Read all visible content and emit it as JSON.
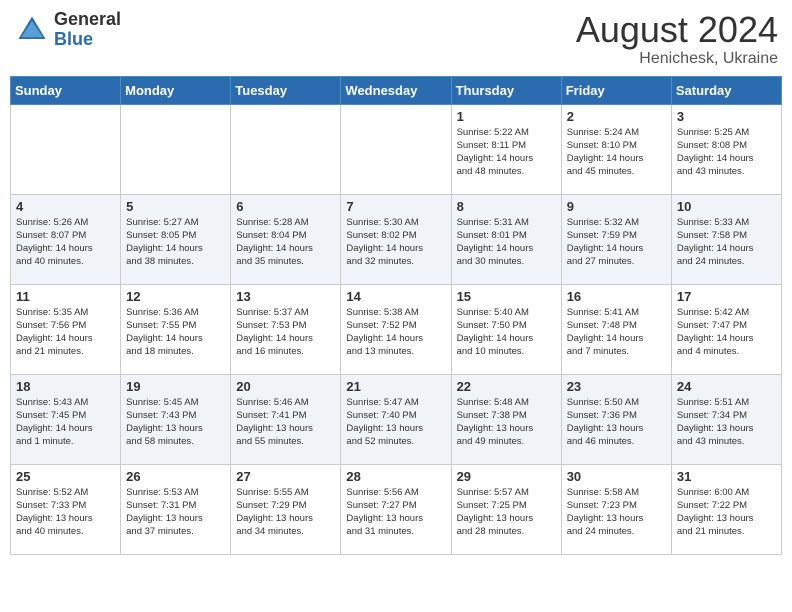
{
  "header": {
    "logo_general": "General",
    "logo_blue": "Blue",
    "month_year": "August 2024",
    "location": "Henichesk, Ukraine"
  },
  "days_of_week": [
    "Sunday",
    "Monday",
    "Tuesday",
    "Wednesday",
    "Thursday",
    "Friday",
    "Saturday"
  ],
  "weeks": [
    [
      {
        "day": "",
        "info": ""
      },
      {
        "day": "",
        "info": ""
      },
      {
        "day": "",
        "info": ""
      },
      {
        "day": "",
        "info": ""
      },
      {
        "day": "1",
        "info": "Sunrise: 5:22 AM\nSunset: 8:11 PM\nDaylight: 14 hours\nand 48 minutes."
      },
      {
        "day": "2",
        "info": "Sunrise: 5:24 AM\nSunset: 8:10 PM\nDaylight: 14 hours\nand 45 minutes."
      },
      {
        "day": "3",
        "info": "Sunrise: 5:25 AM\nSunset: 8:08 PM\nDaylight: 14 hours\nand 43 minutes."
      }
    ],
    [
      {
        "day": "4",
        "info": "Sunrise: 5:26 AM\nSunset: 8:07 PM\nDaylight: 14 hours\nand 40 minutes."
      },
      {
        "day": "5",
        "info": "Sunrise: 5:27 AM\nSunset: 8:05 PM\nDaylight: 14 hours\nand 38 minutes."
      },
      {
        "day": "6",
        "info": "Sunrise: 5:28 AM\nSunset: 8:04 PM\nDaylight: 14 hours\nand 35 minutes."
      },
      {
        "day": "7",
        "info": "Sunrise: 5:30 AM\nSunset: 8:02 PM\nDaylight: 14 hours\nand 32 minutes."
      },
      {
        "day": "8",
        "info": "Sunrise: 5:31 AM\nSunset: 8:01 PM\nDaylight: 14 hours\nand 30 minutes."
      },
      {
        "day": "9",
        "info": "Sunrise: 5:32 AM\nSunset: 7:59 PM\nDaylight: 14 hours\nand 27 minutes."
      },
      {
        "day": "10",
        "info": "Sunrise: 5:33 AM\nSunset: 7:58 PM\nDaylight: 14 hours\nand 24 minutes."
      }
    ],
    [
      {
        "day": "11",
        "info": "Sunrise: 5:35 AM\nSunset: 7:56 PM\nDaylight: 14 hours\nand 21 minutes."
      },
      {
        "day": "12",
        "info": "Sunrise: 5:36 AM\nSunset: 7:55 PM\nDaylight: 14 hours\nand 18 minutes."
      },
      {
        "day": "13",
        "info": "Sunrise: 5:37 AM\nSunset: 7:53 PM\nDaylight: 14 hours\nand 16 minutes."
      },
      {
        "day": "14",
        "info": "Sunrise: 5:38 AM\nSunset: 7:52 PM\nDaylight: 14 hours\nand 13 minutes."
      },
      {
        "day": "15",
        "info": "Sunrise: 5:40 AM\nSunset: 7:50 PM\nDaylight: 14 hours\nand 10 minutes."
      },
      {
        "day": "16",
        "info": "Sunrise: 5:41 AM\nSunset: 7:48 PM\nDaylight: 14 hours\nand 7 minutes."
      },
      {
        "day": "17",
        "info": "Sunrise: 5:42 AM\nSunset: 7:47 PM\nDaylight: 14 hours\nand 4 minutes."
      }
    ],
    [
      {
        "day": "18",
        "info": "Sunrise: 5:43 AM\nSunset: 7:45 PM\nDaylight: 14 hours\nand 1 minute."
      },
      {
        "day": "19",
        "info": "Sunrise: 5:45 AM\nSunset: 7:43 PM\nDaylight: 13 hours\nand 58 minutes."
      },
      {
        "day": "20",
        "info": "Sunrise: 5:46 AM\nSunset: 7:41 PM\nDaylight: 13 hours\nand 55 minutes."
      },
      {
        "day": "21",
        "info": "Sunrise: 5:47 AM\nSunset: 7:40 PM\nDaylight: 13 hours\nand 52 minutes."
      },
      {
        "day": "22",
        "info": "Sunrise: 5:48 AM\nSunset: 7:38 PM\nDaylight: 13 hours\nand 49 minutes."
      },
      {
        "day": "23",
        "info": "Sunrise: 5:50 AM\nSunset: 7:36 PM\nDaylight: 13 hours\nand 46 minutes."
      },
      {
        "day": "24",
        "info": "Sunrise: 5:51 AM\nSunset: 7:34 PM\nDaylight: 13 hours\nand 43 minutes."
      }
    ],
    [
      {
        "day": "25",
        "info": "Sunrise: 5:52 AM\nSunset: 7:33 PM\nDaylight: 13 hours\nand 40 minutes."
      },
      {
        "day": "26",
        "info": "Sunrise: 5:53 AM\nSunset: 7:31 PM\nDaylight: 13 hours\nand 37 minutes."
      },
      {
        "day": "27",
        "info": "Sunrise: 5:55 AM\nSunset: 7:29 PM\nDaylight: 13 hours\nand 34 minutes."
      },
      {
        "day": "28",
        "info": "Sunrise: 5:56 AM\nSunset: 7:27 PM\nDaylight: 13 hours\nand 31 minutes."
      },
      {
        "day": "29",
        "info": "Sunrise: 5:57 AM\nSunset: 7:25 PM\nDaylight: 13 hours\nand 28 minutes."
      },
      {
        "day": "30",
        "info": "Sunrise: 5:58 AM\nSunset: 7:23 PM\nDaylight: 13 hours\nand 24 minutes."
      },
      {
        "day": "31",
        "info": "Sunrise: 6:00 AM\nSunset: 7:22 PM\nDaylight: 13 hours\nand 21 minutes."
      }
    ]
  ]
}
